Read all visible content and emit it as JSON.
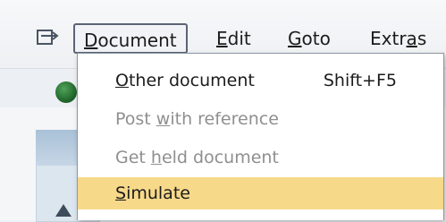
{
  "menubar": {
    "items": [
      {
        "pre": "",
        "ul": "D",
        "post": "ocument",
        "active": true
      },
      {
        "pre": "",
        "ul": "E",
        "post": "dit",
        "active": false
      },
      {
        "pre": "",
        "ul": "G",
        "post": "oto",
        "active": false
      },
      {
        "pre": "Extr",
        "ul": "a",
        "post": "s",
        "active": false
      }
    ]
  },
  "dropdown": {
    "items": [
      {
        "pre": "",
        "ul": "O",
        "post": "ther document",
        "shortcut": "Shift+F5",
        "state": "enabled"
      },
      {
        "pre": "Post ",
        "ul": "w",
        "post": "ith reference",
        "shortcut": "",
        "state": "disabled"
      },
      {
        "pre": "Get ",
        "ul": "h",
        "post": "eld document",
        "shortcut": "",
        "state": "disabled"
      },
      {
        "pre": "",
        "ul": "S",
        "post": "imulate",
        "shortcut": "",
        "state": "highlighted"
      }
    ]
  },
  "colors": {
    "highlight": "#f7d98a",
    "disabled_text": "#8f8f8f",
    "menu_border": "#5a6474"
  },
  "icons": {
    "menu_toggle": "menu-toggle-icon",
    "toolbar": "enter-icon"
  }
}
